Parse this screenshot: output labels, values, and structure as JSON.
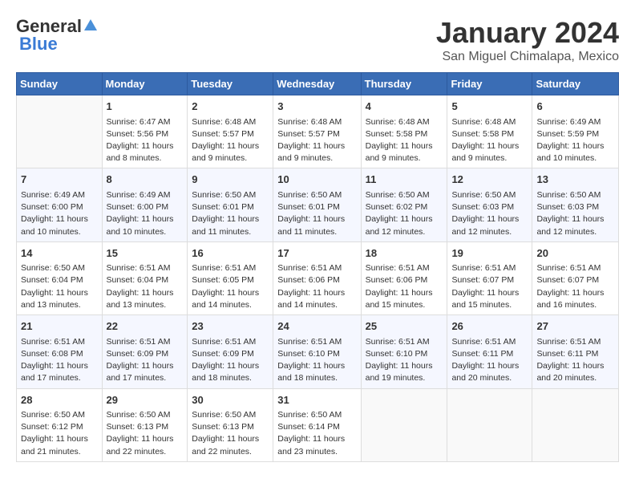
{
  "logo": {
    "general": "General",
    "blue": "Blue"
  },
  "title": "January 2024",
  "location": "San Miguel Chimalapa, Mexico",
  "days_of_week": [
    "Sunday",
    "Monday",
    "Tuesday",
    "Wednesday",
    "Thursday",
    "Friday",
    "Saturday"
  ],
  "weeks": [
    [
      {
        "day": "",
        "info": ""
      },
      {
        "day": "1",
        "info": "Sunrise: 6:47 AM\nSunset: 5:56 PM\nDaylight: 11 hours\nand 8 minutes."
      },
      {
        "day": "2",
        "info": "Sunrise: 6:48 AM\nSunset: 5:57 PM\nDaylight: 11 hours\nand 9 minutes."
      },
      {
        "day": "3",
        "info": "Sunrise: 6:48 AM\nSunset: 5:57 PM\nDaylight: 11 hours\nand 9 minutes."
      },
      {
        "day": "4",
        "info": "Sunrise: 6:48 AM\nSunset: 5:58 PM\nDaylight: 11 hours\nand 9 minutes."
      },
      {
        "day": "5",
        "info": "Sunrise: 6:48 AM\nSunset: 5:58 PM\nDaylight: 11 hours\nand 9 minutes."
      },
      {
        "day": "6",
        "info": "Sunrise: 6:49 AM\nSunset: 5:59 PM\nDaylight: 11 hours\nand 10 minutes."
      }
    ],
    [
      {
        "day": "7",
        "info": "Sunrise: 6:49 AM\nSunset: 6:00 PM\nDaylight: 11 hours\nand 10 minutes."
      },
      {
        "day": "8",
        "info": "Sunrise: 6:49 AM\nSunset: 6:00 PM\nDaylight: 11 hours\nand 10 minutes."
      },
      {
        "day": "9",
        "info": "Sunrise: 6:50 AM\nSunset: 6:01 PM\nDaylight: 11 hours\nand 11 minutes."
      },
      {
        "day": "10",
        "info": "Sunrise: 6:50 AM\nSunset: 6:01 PM\nDaylight: 11 hours\nand 11 minutes."
      },
      {
        "day": "11",
        "info": "Sunrise: 6:50 AM\nSunset: 6:02 PM\nDaylight: 11 hours\nand 12 minutes."
      },
      {
        "day": "12",
        "info": "Sunrise: 6:50 AM\nSunset: 6:03 PM\nDaylight: 11 hours\nand 12 minutes."
      },
      {
        "day": "13",
        "info": "Sunrise: 6:50 AM\nSunset: 6:03 PM\nDaylight: 11 hours\nand 12 minutes."
      }
    ],
    [
      {
        "day": "14",
        "info": "Sunrise: 6:50 AM\nSunset: 6:04 PM\nDaylight: 11 hours\nand 13 minutes."
      },
      {
        "day": "15",
        "info": "Sunrise: 6:51 AM\nSunset: 6:04 PM\nDaylight: 11 hours\nand 13 minutes."
      },
      {
        "day": "16",
        "info": "Sunrise: 6:51 AM\nSunset: 6:05 PM\nDaylight: 11 hours\nand 14 minutes."
      },
      {
        "day": "17",
        "info": "Sunrise: 6:51 AM\nSunset: 6:06 PM\nDaylight: 11 hours\nand 14 minutes."
      },
      {
        "day": "18",
        "info": "Sunrise: 6:51 AM\nSunset: 6:06 PM\nDaylight: 11 hours\nand 15 minutes."
      },
      {
        "day": "19",
        "info": "Sunrise: 6:51 AM\nSunset: 6:07 PM\nDaylight: 11 hours\nand 15 minutes."
      },
      {
        "day": "20",
        "info": "Sunrise: 6:51 AM\nSunset: 6:07 PM\nDaylight: 11 hours\nand 16 minutes."
      }
    ],
    [
      {
        "day": "21",
        "info": "Sunrise: 6:51 AM\nSunset: 6:08 PM\nDaylight: 11 hours\nand 17 minutes."
      },
      {
        "day": "22",
        "info": "Sunrise: 6:51 AM\nSunset: 6:09 PM\nDaylight: 11 hours\nand 17 minutes."
      },
      {
        "day": "23",
        "info": "Sunrise: 6:51 AM\nSunset: 6:09 PM\nDaylight: 11 hours\nand 18 minutes."
      },
      {
        "day": "24",
        "info": "Sunrise: 6:51 AM\nSunset: 6:10 PM\nDaylight: 11 hours\nand 18 minutes."
      },
      {
        "day": "25",
        "info": "Sunrise: 6:51 AM\nSunset: 6:10 PM\nDaylight: 11 hours\nand 19 minutes."
      },
      {
        "day": "26",
        "info": "Sunrise: 6:51 AM\nSunset: 6:11 PM\nDaylight: 11 hours\nand 20 minutes."
      },
      {
        "day": "27",
        "info": "Sunrise: 6:51 AM\nSunset: 6:11 PM\nDaylight: 11 hours\nand 20 minutes."
      }
    ],
    [
      {
        "day": "28",
        "info": "Sunrise: 6:50 AM\nSunset: 6:12 PM\nDaylight: 11 hours\nand 21 minutes."
      },
      {
        "day": "29",
        "info": "Sunrise: 6:50 AM\nSunset: 6:13 PM\nDaylight: 11 hours\nand 22 minutes."
      },
      {
        "day": "30",
        "info": "Sunrise: 6:50 AM\nSunset: 6:13 PM\nDaylight: 11 hours\nand 22 minutes."
      },
      {
        "day": "31",
        "info": "Sunrise: 6:50 AM\nSunset: 6:14 PM\nDaylight: 11 hours\nand 23 minutes."
      },
      {
        "day": "",
        "info": ""
      },
      {
        "day": "",
        "info": ""
      },
      {
        "day": "",
        "info": ""
      }
    ]
  ]
}
